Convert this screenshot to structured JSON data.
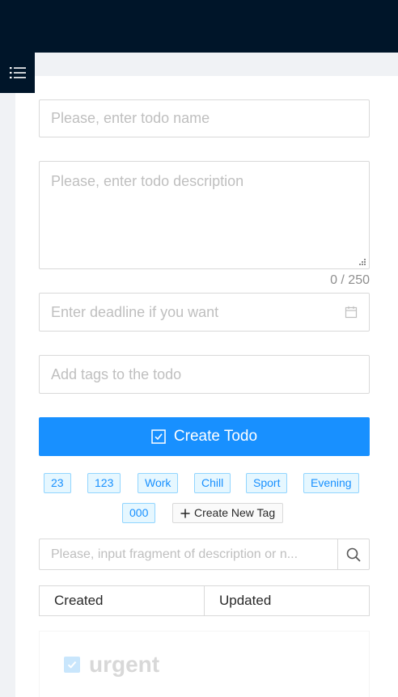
{
  "form": {
    "name_placeholder": "Please, enter todo name",
    "description_placeholder": "Please, enter todo description",
    "description_counter": "0 / 250",
    "deadline_placeholder": "Enter deadline if you want",
    "tags_placeholder": "Add tags to the todo",
    "create_label": "Create Todo"
  },
  "tags": [
    "23",
    "123",
    "Work",
    "Chill",
    "Sport",
    "Evening",
    "000"
  ],
  "new_tag_label": "Create New Tag",
  "search": {
    "placeholder": "Please, input fragment of description or n..."
  },
  "sort": {
    "created_label": "Created",
    "updated_label": "Updated"
  },
  "todo": {
    "title": "urgent"
  },
  "colors": {
    "header": "#001529",
    "primary": "#1890ff",
    "tag_bg": "#e6f7ff",
    "tag_border": "#91d5ff"
  },
  "icons": [
    "menu-icon",
    "resize-handle-icon",
    "calendar-icon",
    "check-square-icon",
    "plus-icon",
    "search-icon",
    "checkbox-icon"
  ]
}
